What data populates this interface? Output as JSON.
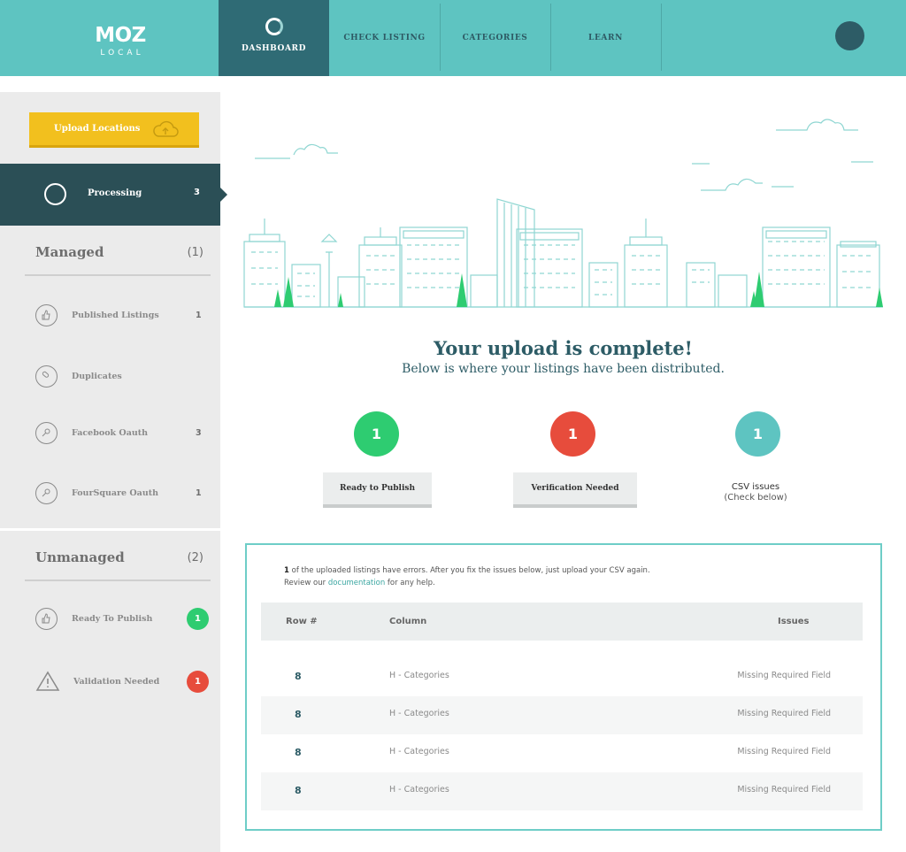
{
  "brand": {
    "name": "MOZ",
    "sub": "LOCAL"
  },
  "nav": {
    "items": [
      {
        "label": "DASHBOARD"
      },
      {
        "label": "CHECK LISTING"
      },
      {
        "label": "CATEGORIES"
      },
      {
        "label": "LEARN"
      }
    ]
  },
  "sidebar": {
    "upload_label": "Upload Locations",
    "processing": {
      "label": "Processing",
      "count": "3"
    },
    "managed": {
      "title": "Managed",
      "count": "(1)",
      "items": [
        {
          "label": "Published Listings",
          "count": "1"
        },
        {
          "label": "Duplicates",
          "count": ""
        },
        {
          "label": "Facebook Oauth",
          "count": "3"
        },
        {
          "label": "FourSquare Oauth",
          "count": "1"
        }
      ]
    },
    "unmanaged": {
      "title": "Unmanaged",
      "count": "(2)",
      "items": [
        {
          "label": "Ready To Publish",
          "count": "1",
          "color": "#2ecc71"
        },
        {
          "label": "Validation Needed",
          "count": "1",
          "color": "#e74c3c"
        }
      ]
    }
  },
  "main": {
    "title": "Your upload is complete!",
    "subtitle": "Below is where your listings have been distributed.",
    "stats": [
      {
        "value": "1",
        "label": "Ready to Publish",
        "color": "#2ecc71"
      },
      {
        "value": "1",
        "label": "Verification Needed",
        "color": "#e74c3c"
      },
      {
        "value": "1",
        "label": "CSV issues",
        "sublabel": "(Check below)",
        "color": "#5ec4c1"
      }
    ],
    "errors": {
      "count": "1",
      "message": " of the uploaded listings have errors. After you fix the issues below, just upload your CSV again.",
      "review_prefix": "Review our ",
      "link": "documentation",
      "review_suffix": " for any help.",
      "columns": [
        "Row #",
        "Column",
        "Issues"
      ],
      "rows": [
        {
          "row": "8",
          "column": "H - Categories",
          "issue": "Missing Required Field"
        },
        {
          "row": "8",
          "column": "H - Categories",
          "issue": "Missing Required Field"
        },
        {
          "row": "8",
          "column": "H - Categories",
          "issue": "Missing Required Field"
        },
        {
          "row": "8",
          "column": "H - Categories",
          "issue": "Missing Required Field"
        }
      ]
    }
  },
  "colors": {
    "teal": "#5ec4c1",
    "dark_teal": "#2b4f56",
    "yellow": "#f2c01e",
    "green": "#2ecc71",
    "red": "#e74c3c"
  }
}
